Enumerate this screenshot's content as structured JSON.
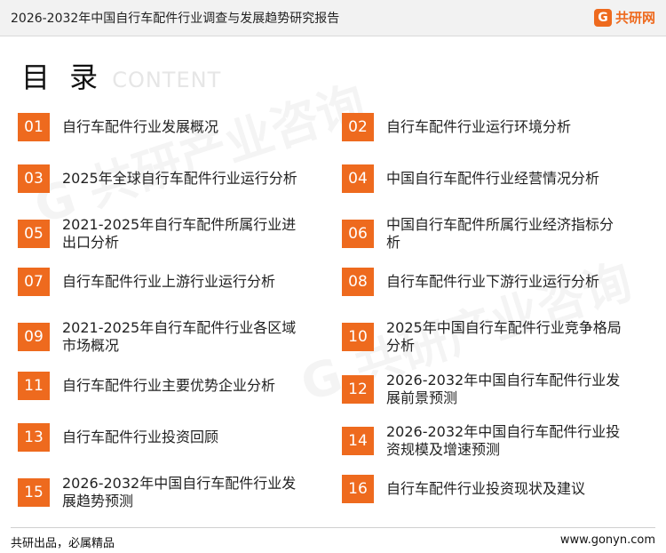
{
  "header": {
    "report_title": "2026-2032年中国自行车配件行业调查与发展趋势研究报告",
    "logo_text": "共研网"
  },
  "heading": {
    "cn": "目 录",
    "en": "CONTENT"
  },
  "accent_color": "#ee6a1e",
  "toc": [
    {
      "num": "01",
      "label": "自行车配件行业发展概况"
    },
    {
      "num": "02",
      "label": "自行车配件行业运行环境分析"
    },
    {
      "num": "03",
      "label": "2025年全球自行车配件行业运行分析"
    },
    {
      "num": "04",
      "label": "中国自行车配件行业经营情况分析"
    },
    {
      "num": "05",
      "label": "2021-2025年自行车配件所属行业进出口分析"
    },
    {
      "num": "06",
      "label": "中国自行车配件所属行业经济指标分析"
    },
    {
      "num": "07",
      "label": "自行车配件行业上游行业运行分析"
    },
    {
      "num": "08",
      "label": "自行车配件行业下游行业运行分析"
    },
    {
      "num": "09",
      "label": "2021-2025年自行车配件行业各区域市场概况"
    },
    {
      "num": "10",
      "label": "2025年中国自行车配件行业竞争格局分析"
    },
    {
      "num": "11",
      "label": "自行车配件行业主要优势企业分析"
    },
    {
      "num": "12",
      "label": "2026-2032年中国自行车配件行业发展前景预测"
    },
    {
      "num": "13",
      "label": "自行车配件行业投资回顾"
    },
    {
      "num": "14",
      "label": "2026-2032年中国自行车配件行业投资规模及增速预测"
    },
    {
      "num": "15",
      "label": "2026-2032年中国自行车配件行业发展趋势预测"
    },
    {
      "num": "16",
      "label": "自行车配件行业投资现状及建议"
    }
  ],
  "footer": {
    "slogan": "共研出品，必属精品",
    "url": "www.gonyn.com"
  }
}
